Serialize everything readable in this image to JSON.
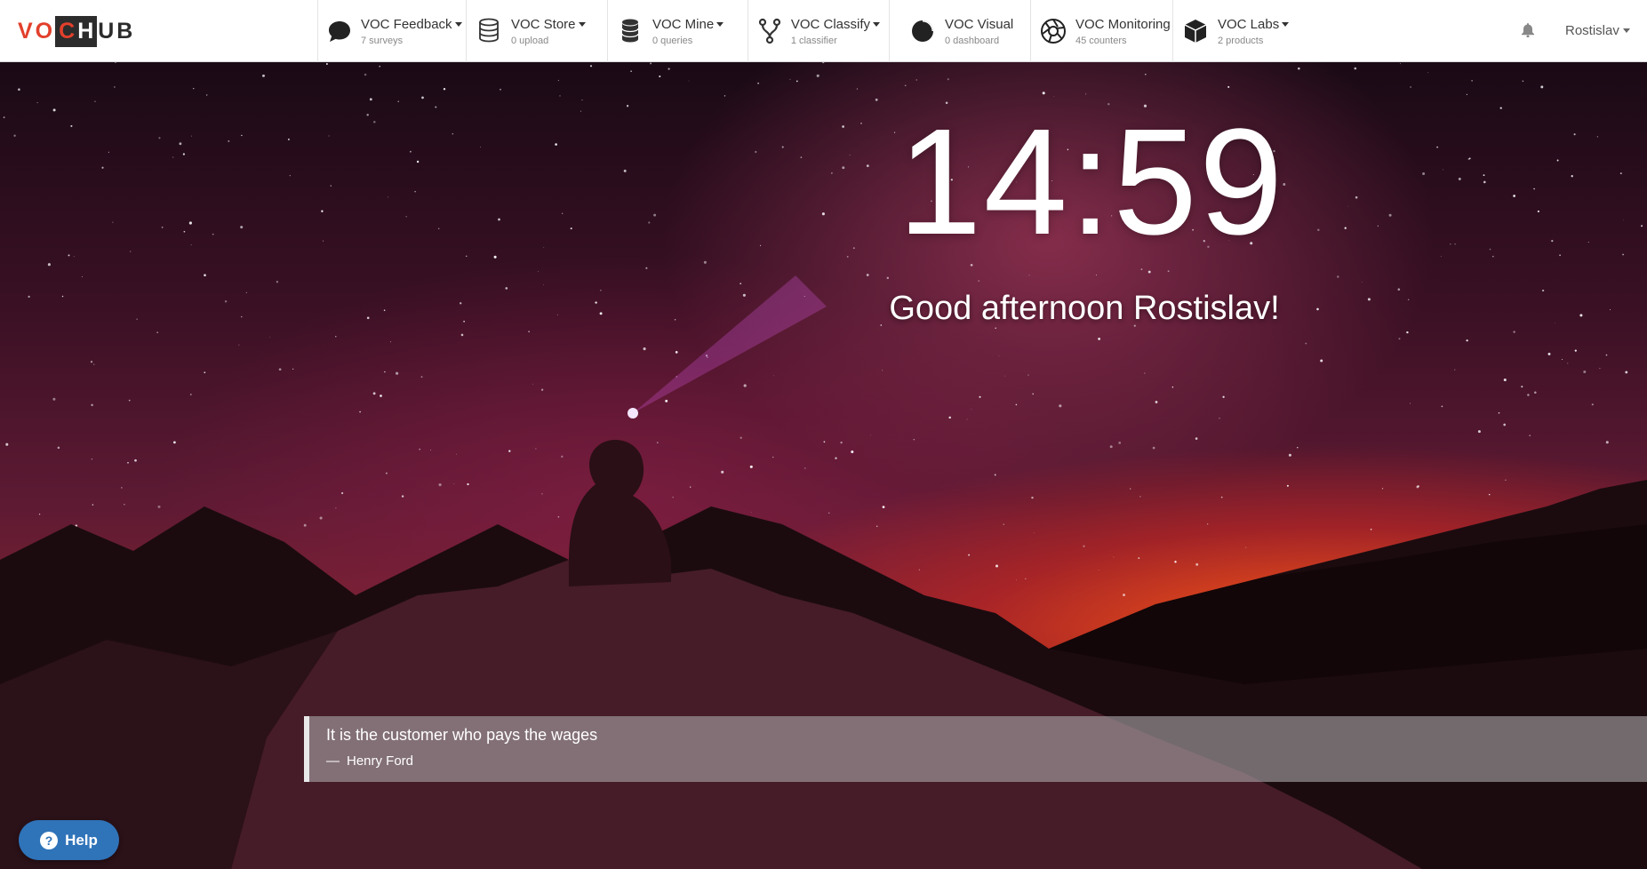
{
  "logo": {
    "part1": "VO",
    "part2": "C",
    "part3": "H",
    "part4": "UB"
  },
  "nav": [
    {
      "title": "VOC Feedback",
      "sub": "7 surveys",
      "icon": "speech-bubble-icon",
      "dropdown": true
    },
    {
      "title": "VOC Store",
      "sub": "0 upload",
      "icon": "database-stack-icon",
      "dropdown": true
    },
    {
      "title": "VOC Mine",
      "sub": "0 queries",
      "icon": "database-cylinder-icon",
      "dropdown": true
    },
    {
      "title": "VOC Classify",
      "sub": "1 classifier",
      "icon": "branch-icon",
      "dropdown": true
    },
    {
      "title": "VOC Visual",
      "sub": "0 dashboard",
      "icon": "pie-chart-icon",
      "dropdown": false
    },
    {
      "title": "VOC Monitoring",
      "sub": "45 counters",
      "icon": "aperture-icon",
      "dropdown": false
    },
    {
      "title": "VOC Labs",
      "sub": "2 products",
      "icon": "cube-icon",
      "dropdown": true
    }
  ],
  "user": {
    "name": "Rostislav"
  },
  "clock": {
    "time": "14:59"
  },
  "greeting": "Good afternoon Rostislav!",
  "quote": {
    "text": "It is the customer who pays the wages",
    "dash": "—",
    "author": "Henry Ford"
  },
  "help": {
    "label": "Help"
  },
  "colors": {
    "brand": "#e2402c",
    "help": "#2f73b9"
  }
}
